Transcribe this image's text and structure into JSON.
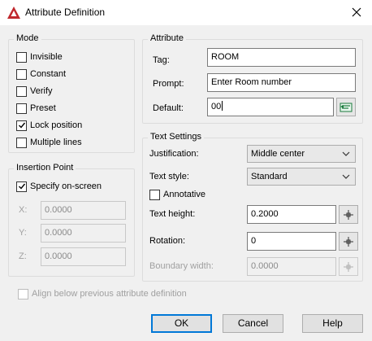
{
  "window": {
    "title": "Attribute Definition",
    "accent": "#c0282d"
  },
  "mode": {
    "label": "Mode",
    "items": [
      {
        "label": "Invisible",
        "checked": false
      },
      {
        "label": "Constant",
        "checked": false
      },
      {
        "label": "Verify",
        "checked": false
      },
      {
        "label": "Preset",
        "checked": false
      },
      {
        "label": "Lock position",
        "checked": true
      },
      {
        "label": "Multiple lines",
        "checked": false
      }
    ]
  },
  "insertion": {
    "label": "Insertion Point",
    "specify_label": "Specify on-screen",
    "specify_checked": true,
    "x_label": "X:",
    "x_value": "0.0000",
    "y_label": "Y:",
    "y_value": "0.0000",
    "z_label": "Z:",
    "z_value": "0.0000"
  },
  "attribute": {
    "label": "Attribute",
    "tag_label": "Tag:",
    "tag_value": "ROOM",
    "prompt_label": "Prompt:",
    "prompt_value": "Enter Room number",
    "default_label": "Default:",
    "default_value": "00"
  },
  "text_settings": {
    "label": "Text Settings",
    "justification_label": "Justification:",
    "justification_value": "Middle center",
    "style_label": "Text style:",
    "style_value": "Standard",
    "annotative_label": "Annotative",
    "annotative_checked": false,
    "height_label": "Text height:",
    "height_value": "0.2000",
    "rotation_label": "Rotation:",
    "rotation_value": "0",
    "boundary_label": "Boundary width:",
    "boundary_value": "0.0000"
  },
  "align_label": "Align below previous attribute definition",
  "buttons": {
    "ok": "OK",
    "cancel": "Cancel",
    "help": "Help"
  }
}
